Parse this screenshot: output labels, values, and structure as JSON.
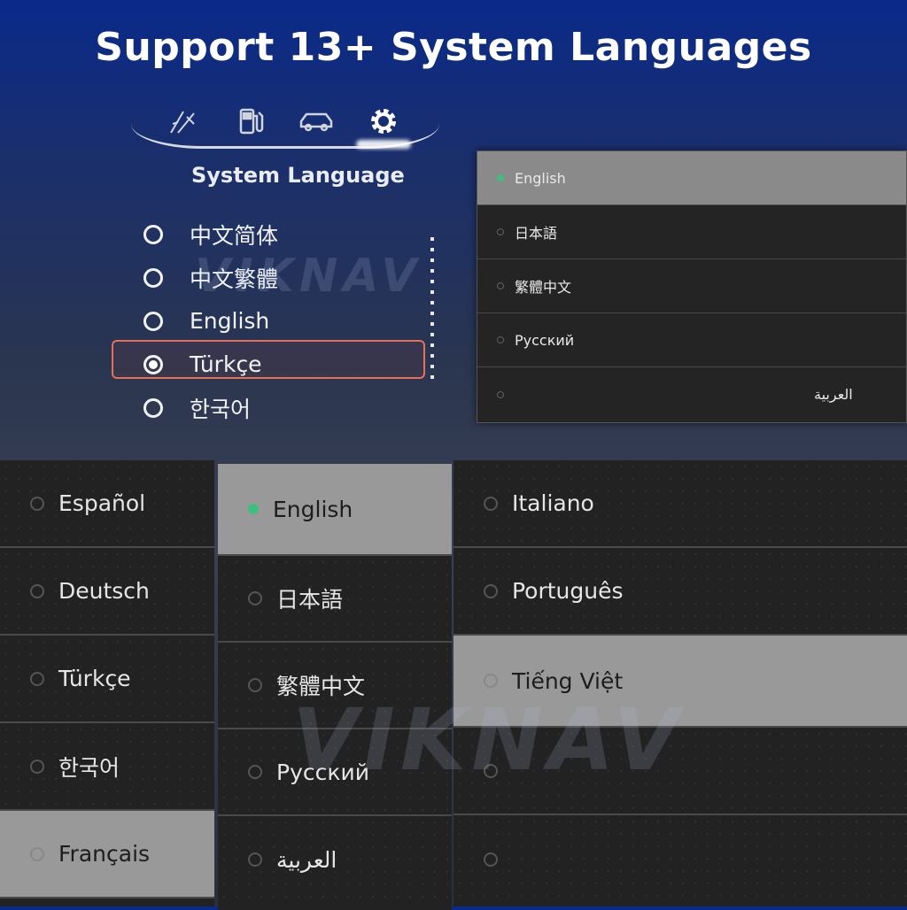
{
  "title": "Support 13+ System Languages",
  "car_panel": {
    "tabs": [
      {
        "name": "tools-icon"
      },
      {
        "name": "fuel-icon"
      },
      {
        "name": "car-icon"
      },
      {
        "name": "gear-icon",
        "active": true
      }
    ],
    "heading": "System Language",
    "languages": [
      {
        "label": "中文简体",
        "selected": false
      },
      {
        "label": "中文繁體",
        "selected": false
      },
      {
        "label": "English",
        "selected": false
      },
      {
        "label": "Türkçe",
        "selected": true
      },
      {
        "label": "한국어",
        "selected": false
      }
    ],
    "accent_color": "#e3715a"
  },
  "menu_small": {
    "items": [
      {
        "label": "English",
        "selected": true
      },
      {
        "label": "日本語",
        "selected": false
      },
      {
        "label": "繁體中文",
        "selected": false
      },
      {
        "label": "Русский",
        "selected": false
      },
      {
        "label": "العربية",
        "selected": false
      }
    ]
  },
  "column_left": {
    "items": [
      {
        "label": "Español"
      },
      {
        "label": "Deutsch"
      },
      {
        "label": "Türkçe"
      },
      {
        "label": "한국어"
      },
      {
        "label": "Français",
        "highlighted": true
      }
    ]
  },
  "column_mid": {
    "items": [
      {
        "label": "English",
        "selected": true,
        "highlighted": true
      },
      {
        "label": "日本語"
      },
      {
        "label": "繁體中文"
      },
      {
        "label": "Русский"
      },
      {
        "label": "العربية"
      }
    ]
  },
  "column_right": {
    "items": [
      {
        "label": "Italiano"
      },
      {
        "label": "Português"
      },
      {
        "label": "Tiếng Việt",
        "highlighted": true
      },
      {
        "label": ""
      },
      {
        "label": ""
      }
    ]
  },
  "watermark": "VIKNAV",
  "selected_indicator_color": "#3fbf7f"
}
